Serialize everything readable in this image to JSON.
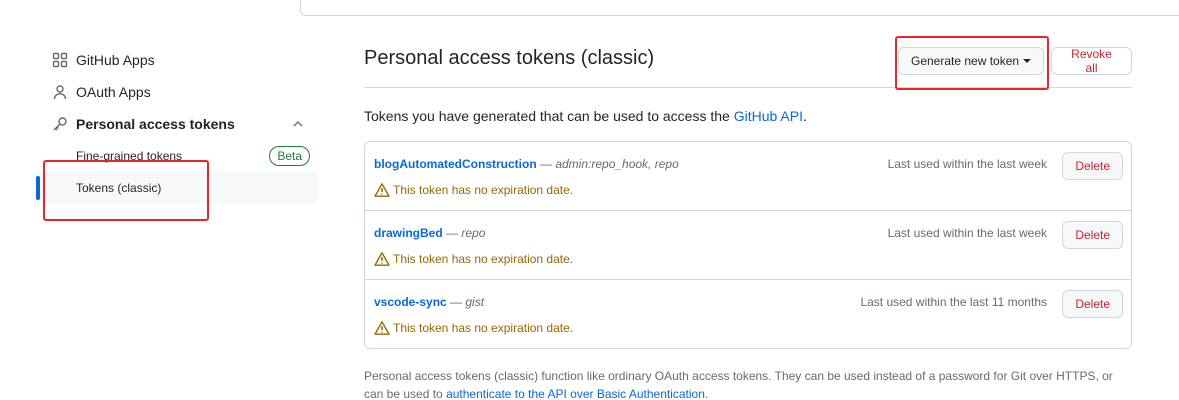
{
  "sidebar": {
    "items": [
      {
        "label": "GitHub Apps",
        "icon": "apps-icon"
      },
      {
        "label": "OAuth Apps",
        "icon": "person-icon"
      },
      {
        "label": "Personal access tokens",
        "icon": "key-icon"
      }
    ],
    "sub_items": [
      {
        "label": "Fine-grained tokens",
        "badge": "Beta"
      },
      {
        "label": "Tokens (classic)",
        "active": true
      }
    ]
  },
  "main": {
    "title": "Personal access tokens (classic)",
    "generate_label": "Generate new token",
    "revoke_label": "Revoke all",
    "intro_text": "Tokens you have generated that can be used to access the ",
    "intro_link": "GitHub API",
    "intro_end": ".",
    "tokens": [
      {
        "name": "blogAutomatedConstruction",
        "sep": " — ",
        "scopes": "admin:repo_hook, repo",
        "last_used": "Last used within the last week",
        "warning": "This token has no expiration date.",
        "delete_label": "Delete"
      },
      {
        "name": "drawingBed",
        "sep": " — ",
        "scopes": "repo",
        "last_used": "Last used within the last week",
        "warning": "This token has no expiration date.",
        "delete_label": "Delete"
      },
      {
        "name": "vscode-sync",
        "sep": " — ",
        "scopes": "gist",
        "last_used": "Last used within the last 11 months",
        "warning": "This token has no expiration date.",
        "delete_label": "Delete"
      }
    ],
    "footer_text": "Personal access tokens (classic) function like ordinary OAuth access tokens. They can be used instead of a password for Git over HTTPS, or can be used to ",
    "footer_link": "authenticate to the API over Basic Authentication",
    "footer_end": "."
  },
  "colors": {
    "link": "#0969da",
    "danger": "#cf222e",
    "warning": "#9a6700",
    "success": "#1a7f37",
    "annotation": "#e8262a"
  }
}
